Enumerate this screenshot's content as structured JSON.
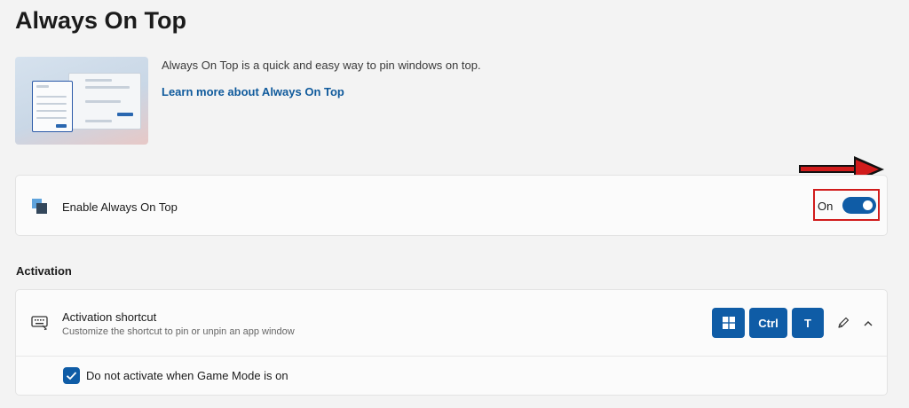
{
  "page": {
    "title": "Always On Top"
  },
  "intro": {
    "description": "Always On Top is a quick and easy way to pin windows on top.",
    "link_label": "Learn more about Always On Top"
  },
  "enable": {
    "label": "Enable Always On Top",
    "state_label": "On",
    "is_on": true,
    "icon": "always-on-top-icon"
  },
  "activation": {
    "section_title": "Activation",
    "shortcut_title": "Activation shortcut",
    "shortcut_subtitle": "Customize the shortcut to pin or unpin an app window",
    "keys": [
      "windows-key-icon",
      "Ctrl",
      "T"
    ],
    "ctrl_label": "Ctrl",
    "t_label": "T",
    "game_mode_label": "Do not activate when Game Mode is on",
    "game_mode_checked": true
  },
  "colors": {
    "accent": "#0f5ca6",
    "highlight_box": "#d11c1c",
    "link": "#0f5a9c"
  }
}
